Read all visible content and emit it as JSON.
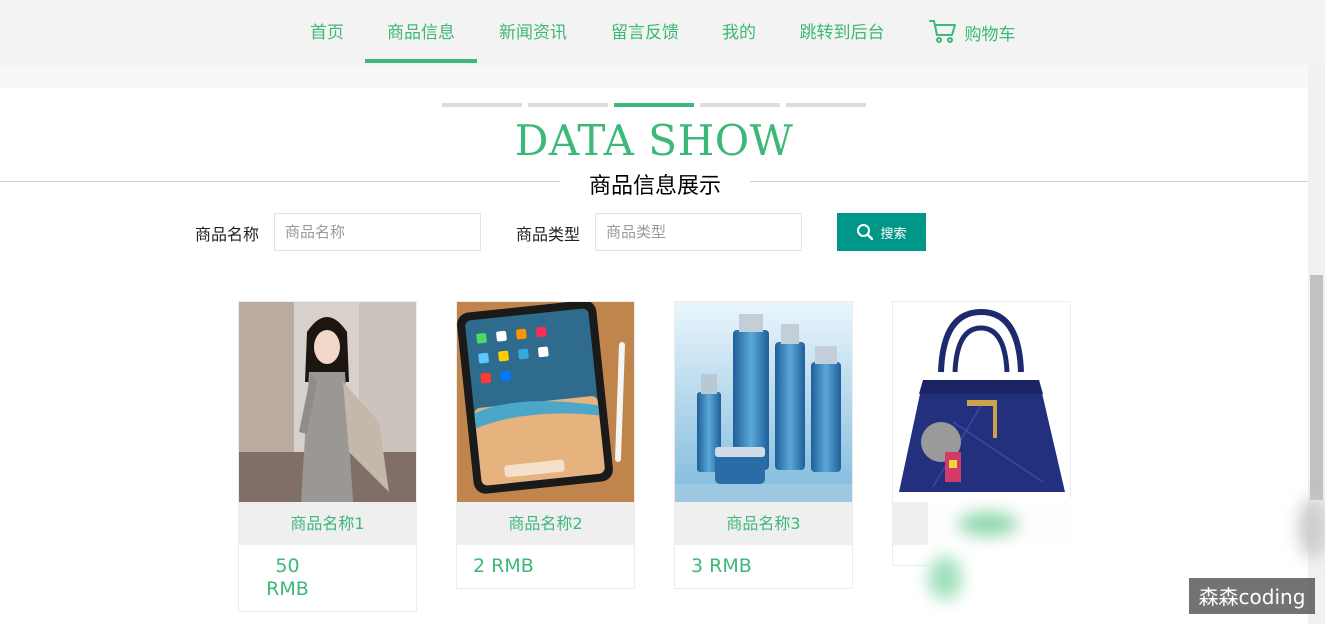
{
  "nav": {
    "items": [
      {
        "label": "首页"
      },
      {
        "label": "商品信息"
      },
      {
        "label": "新闻资讯"
      },
      {
        "label": "留言反馈"
      },
      {
        "label": "我的"
      },
      {
        "label": "跳转到后台"
      },
      {
        "label": "购物车"
      }
    ],
    "active": "商品信息",
    "cart_icon": "shopping-cart-icon"
  },
  "section": {
    "title": "DATA SHOW",
    "subtitle": "商品信息展示"
  },
  "search": {
    "name_label": "商品名称",
    "name_placeholder": "商品名称",
    "type_label": "商品类型",
    "type_placeholder": "商品类型",
    "button_label": "搜索",
    "button_icon": "search-icon"
  },
  "products": [
    {
      "name": "商品名称1",
      "price": "50 RMB",
      "image": "woman-in-grey-dress-photo"
    },
    {
      "name": "商品名称2",
      "price": "2 RMB",
      "image": "tablet-with-stylus-photo"
    },
    {
      "name": "商品名称3",
      "price": "3 RMB",
      "image": "cosmetics-bottles-photo"
    },
    {
      "name": "",
      "price": "",
      "image": "navy-handbag-photo"
    }
  ],
  "watermark": "森森coding",
  "colors": {
    "accent": "#3cb878",
    "button": "#009688",
    "nav_bg": "#f3f3f3"
  }
}
